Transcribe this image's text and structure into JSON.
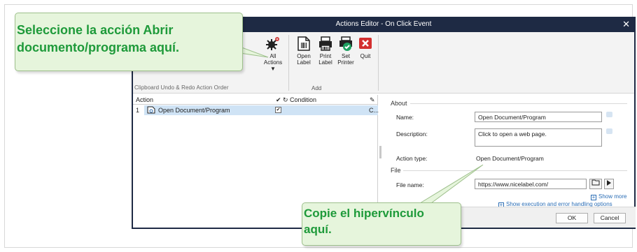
{
  "window": {
    "title": "Actions Editor - On Click Event",
    "close_glyph": "✕"
  },
  "ribbon": {
    "partial_groups": "Clipboard    Undo & Redo    Action Order",
    "all_actions": {
      "line1": "All",
      "line2": "Actions ▼"
    },
    "open_label": {
      "line1": "Open",
      "line2": "Label"
    },
    "print_label": {
      "line1": "Print",
      "line2": "Label"
    },
    "set_printer": {
      "line1": "Set",
      "line2": "Printer"
    },
    "quit": "Quit",
    "add_group": "Add"
  },
  "action_list": {
    "header_action": "Action",
    "header_check": "✔",
    "header_condition": "Condition",
    "header_edit": "✎",
    "rows": [
      {
        "index": "1",
        "name": "Open Document/Program",
        "checked": "✔",
        "condition": "C..."
      }
    ]
  },
  "properties": {
    "about_section": "About",
    "name_label": "Name:",
    "name_value": "Open Document/Program",
    "description_label": "Description:",
    "description_value": "Click to open a web page.",
    "action_type_label": "Action type:",
    "action_type_value": "Open Document/Program",
    "file_section": "File",
    "file_name_label": "File name:",
    "file_name_value": "https://www.nicelabel.com/",
    "show_more": "Show more",
    "show_execution": "Show execution and error handling options"
  },
  "dialog_buttons": {
    "ok": "OK",
    "cancel": "Cancel"
  },
  "callouts": {
    "top": {
      "line1": "Seleccione la acción Abrir",
      "line2": "documento/programa aquí."
    },
    "bottom": {
      "line1": "Copie el hipervínculo",
      "line2": "aquí."
    }
  },
  "colors": {
    "titlebar": "#1e2a44",
    "selection": "#cfe3f5",
    "callout_text": "#1e9a3a",
    "callout_bg": "#e6f5dc",
    "link": "#2a6db5"
  }
}
